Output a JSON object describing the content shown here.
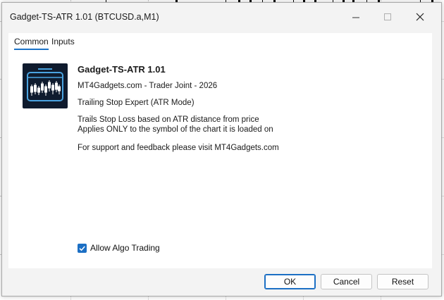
{
  "window": {
    "title": "Gadget-TS-ATR 1.01 (BTCUSD.a,M1)"
  },
  "tabs": [
    {
      "label": "Common"
    },
    {
      "label": "Inputs"
    }
  ],
  "expert": {
    "name": "Gadget-TS-ATR 1.01",
    "vendor": "MT4Gadgets.com - Trader Joint - 2026",
    "subtitle": "Trailing Stop Expert (ATR Mode)",
    "desc_line1": "Trails Stop Loss based on ATR distance from price",
    "desc_line2": "Applies ONLY to the symbol of the chart it is loaded on",
    "support": "For support and feedback please visit MT4Gadgets.com"
  },
  "options": {
    "allow_algo_label": "Allow Algo Trading",
    "allow_algo_checked": true
  },
  "buttons": {
    "ok": "OK",
    "cancel": "Cancel",
    "reset": "Reset"
  },
  "icons": {
    "minimize": "minimize-icon",
    "maximize": "maximize-icon",
    "close": "close-icon",
    "logo": "candlestick-logo-icon",
    "check": "check-icon"
  },
  "colors": {
    "accent": "#1c6fc4",
    "logo_bg": "#0f1b2e",
    "logo_line": "#4aa3e0"
  }
}
